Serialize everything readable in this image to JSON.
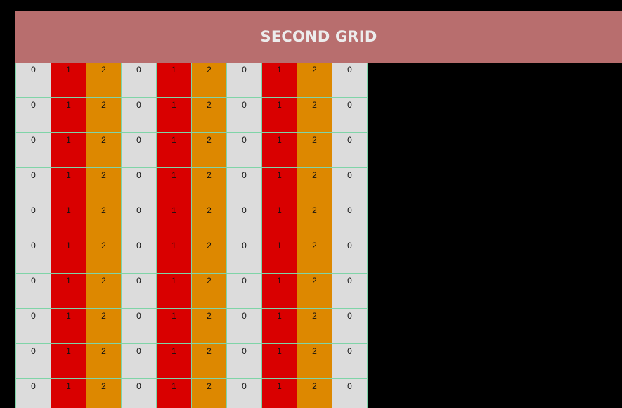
{
  "header": {
    "title": "SECOND GRID"
  },
  "grid": {
    "rows": [
      [
        "0",
        "1",
        "2",
        "0",
        "1",
        "2",
        "0",
        "1",
        "2",
        "0"
      ],
      [
        "0",
        "1",
        "2",
        "0",
        "1",
        "2",
        "0",
        "1",
        "2",
        "0"
      ],
      [
        "0",
        "1",
        "2",
        "0",
        "1",
        "2",
        "0",
        "1",
        "2",
        "0"
      ],
      [
        "0",
        "1",
        "2",
        "0",
        "1",
        "2",
        "0",
        "1",
        "2",
        "0"
      ],
      [
        "0",
        "1",
        "2",
        "0",
        "1",
        "2",
        "0",
        "1",
        "2",
        "0"
      ],
      [
        "0",
        "1",
        "2",
        "0",
        "1",
        "2",
        "0",
        "1",
        "2",
        "0"
      ],
      [
        "0",
        "1",
        "2",
        "0",
        "1",
        "2",
        "0",
        "1",
        "2",
        "0"
      ],
      [
        "0",
        "1",
        "2",
        "0",
        "1",
        "2",
        "0",
        "1",
        "2",
        "0"
      ],
      [
        "0",
        "1",
        "2",
        "0",
        "1",
        "2",
        "0",
        "1",
        "2",
        "0"
      ],
      [
        "0",
        "1",
        "2",
        "0",
        "1",
        "2",
        "0",
        "1",
        "2",
        "0"
      ]
    ],
    "colors": {
      "0": "#dcdcdc",
      "1": "#d90000",
      "2": "#dd8800"
    },
    "border_color": "#7fd4a8"
  },
  "colors": {
    "background": "#000000",
    "header_bg": "#b86e6e",
    "header_text": "#ececec"
  }
}
